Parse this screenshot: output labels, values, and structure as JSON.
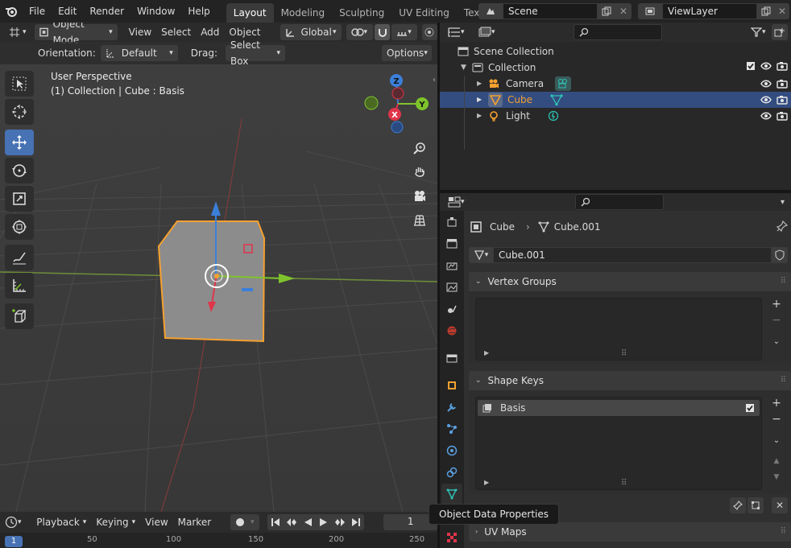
{
  "topbar": {
    "menus": [
      "File",
      "Edit",
      "Render",
      "Window",
      "Help"
    ],
    "workspaces": [
      "Layout",
      "Modeling",
      "Sculpting",
      "UV Editing",
      "Texture Paint"
    ],
    "active_workspace": "Layout",
    "scene": "Scene",
    "view_layer": "ViewLayer"
  },
  "viewport": {
    "mode": "Object Mode",
    "menus": [
      "View",
      "Select",
      "Add",
      "Object"
    ],
    "transform": "Global",
    "orientation_label": "Orientation:",
    "orientation_value": "Default",
    "drag_label": "Drag:",
    "drag_value": "Select Box",
    "options_label": "Options",
    "perspective": "User Perspective",
    "context": "(1) Collection | Cube : Basis",
    "gizmo": {
      "x": "X",
      "y": "Y",
      "z": "Z"
    }
  },
  "outliner": {
    "root": "Scene Collection",
    "collection": "Collection",
    "items": [
      {
        "label": "Camera",
        "selected": false
      },
      {
        "label": "Cube",
        "selected": true
      },
      {
        "label": "Light",
        "selected": false
      }
    ]
  },
  "properties": {
    "breadcrumb_object": "Cube",
    "breadcrumb_data": "Cube.001",
    "data_name": "Cube.001",
    "vertex_groups_title": "Vertex Groups",
    "shape_keys_title": "Shape Keys",
    "shape_key_item": "Basis",
    "uv_maps_title": "UV Maps"
  },
  "timeline": {
    "menus": [
      "Playback",
      "Keying",
      "View",
      "Marker"
    ],
    "current_frame": "1",
    "ruler": [
      "1",
      "50",
      "100",
      "150",
      "200",
      "250"
    ]
  },
  "tooltip": "Object Data Properties",
  "colors": {
    "accent": "#4772b3",
    "selection": "#334d80",
    "object_orange": "#f5a030",
    "mesh_teal": "#2ec4b6",
    "axis_x": "#e0354a",
    "axis_y": "#7fc32c",
    "axis_z": "#3b7fd9"
  }
}
